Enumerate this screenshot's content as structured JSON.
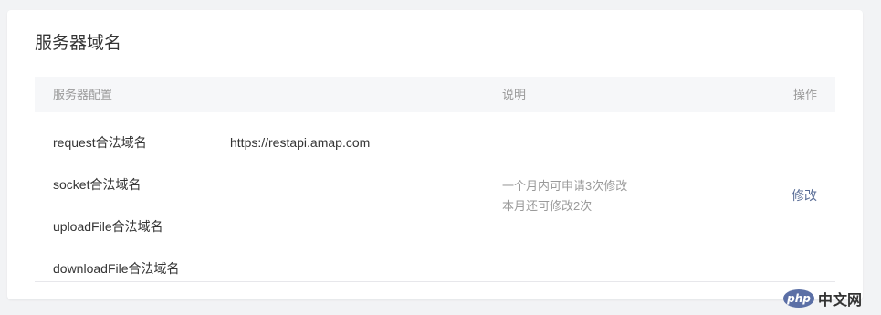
{
  "panel": {
    "title": "服务器域名"
  },
  "table": {
    "headers": {
      "config": "服务器配置",
      "description": "说明",
      "action": "操作"
    },
    "rows": [
      {
        "label": "request合法域名",
        "value": "https://restapi.amap.com"
      },
      {
        "label": "socket合法域名",
        "value": ""
      },
      {
        "label": "uploadFile合法域名",
        "value": ""
      },
      {
        "label": "downloadFile合法域名",
        "value": ""
      }
    ],
    "description_lines": [
      "一个月内可申请3次修改",
      "本月还可修改2次"
    ],
    "action_label": "修改"
  },
  "watermark": {
    "logo_text": "php",
    "site_text": "中文网"
  },
  "colors": {
    "background": "#f2f3f5",
    "card": "#ffffff",
    "header_bg": "#f6f7f9",
    "link": "#576b95",
    "muted_text": "#9a9a9a",
    "primary_text": "#353535"
  }
}
